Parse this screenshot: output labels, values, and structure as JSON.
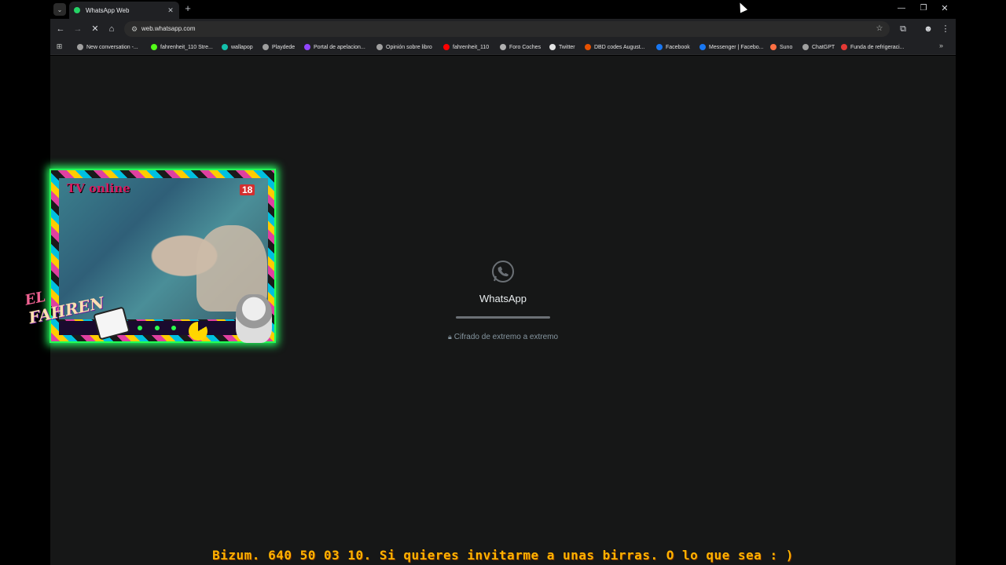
{
  "browser": {
    "tab": {
      "title": "WhatsApp Web",
      "close": "✕"
    },
    "new_tab": "+",
    "window_controls": {
      "minimize": "—",
      "maximize": "❐",
      "close": "✕"
    },
    "url": "web.whatsapp.com",
    "bookmarks": [
      {
        "label": "New conversation -...",
        "icon": "openai-icon",
        "color": "#a0a0a0"
      },
      {
        "label": "fahrenheit_110 Stre...",
        "icon": "kick-icon",
        "color": "#53fc18"
      },
      {
        "label": "wallapop",
        "icon": "wallapop-icon",
        "color": "#13c1ac"
      },
      {
        "label": "Playdede",
        "icon": "playdede-icon",
        "color": "#9e9e9e"
      },
      {
        "label": "Portal de apelacion...",
        "icon": "twitch-icon",
        "color": "#9146ff"
      },
      {
        "label": "Opinión sobre libro",
        "icon": "openai-icon",
        "color": "#a0a0a0"
      },
      {
        "label": "fahrenheit_110",
        "icon": "youtube-icon",
        "color": "#ff0000"
      },
      {
        "label": "Foro Coches",
        "icon": "forocoches-icon",
        "color": "#b0b0b0"
      },
      {
        "label": "Twitter",
        "icon": "x-icon",
        "color": "#e3e3e3"
      },
      {
        "label": "DBD codes August...",
        "icon": "dbd-icon",
        "color": "#e65100"
      },
      {
        "label": "Facebook",
        "icon": "facebook-icon",
        "color": "#1877f2"
      },
      {
        "label": "Messenger | Facebo...",
        "icon": "facebook-icon",
        "color": "#1877f2"
      },
      {
        "label": "Suno",
        "icon": "suno-icon",
        "color": "#ff7043"
      },
      {
        "label": "ChatGPT",
        "icon": "openai-icon",
        "color": "#a0a0a0"
      },
      {
        "label": "Funda de refrigeraci...",
        "icon": "aliexpress-icon",
        "color": "#e53935"
      }
    ]
  },
  "whatsapp": {
    "title": "WhatsApp",
    "encrypted_text": "Cifrado de extremo a extremo",
    "progress": 1.0,
    "accent": "#25d366"
  },
  "overlay": {
    "tv_label": "TV online",
    "age_badge": "18",
    "name_line1": "EL",
    "name_line2": "FAHREN"
  },
  "ticker": "Bizum. 640 50 03 10.  Si quieres invitarme a unas birras. O lo que sea  : )"
}
